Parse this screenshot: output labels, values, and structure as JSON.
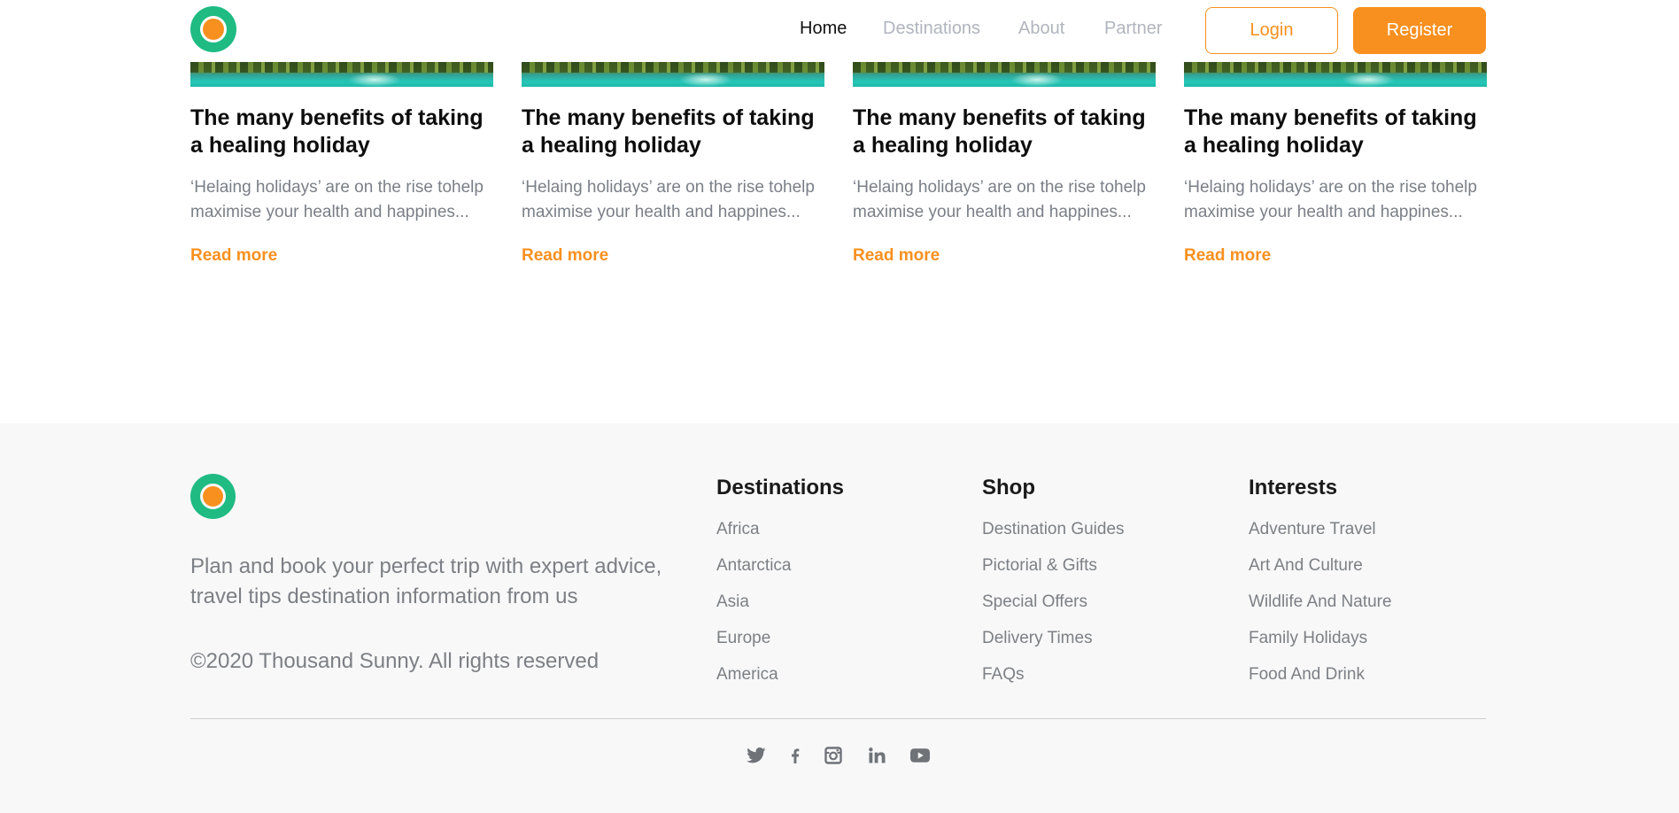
{
  "header": {
    "nav": [
      {
        "label": "Home",
        "active": true
      },
      {
        "label": "Destinations",
        "active": false
      },
      {
        "label": "About",
        "active": false
      },
      {
        "label": "Partner",
        "active": false
      }
    ],
    "login_label": "Login",
    "register_label": "Register"
  },
  "cards": [
    {
      "title": "The many benefits of taking a healing holiday",
      "excerpt": "‘Helaing holidays’ are on the rise tohelp maximise your health and happines...",
      "link": "Read more"
    },
    {
      "title": "The many benefits of taking a healing holiday",
      "excerpt": "‘Helaing holidays’ are on the rise tohelp maximise your health and happines...",
      "link": "Read more"
    },
    {
      "title": "The many benefits of taking a healing holiday",
      "excerpt": "‘Helaing holidays’ are on the rise tohelp maximise your health and happines...",
      "link": "Read more"
    },
    {
      "title": "The many benefits of taking a healing holiday",
      "excerpt": "‘Helaing holidays’ are on the rise tohelp maximise your health and happines...",
      "link": "Read more"
    }
  ],
  "footer": {
    "tagline": "Plan and book your perfect trip with expert advice, travel tips destination information from us",
    "copyright": "©2020 Thousand Sunny. All rights reserved",
    "columns": [
      {
        "title": "Destinations",
        "items": [
          "Africa",
          "Antarctica",
          "Asia",
          "Europe",
          "America"
        ]
      },
      {
        "title": "Shop",
        "items": [
          "Destination Guides",
          "Pictorial & Gifts",
          "Special Offers",
          "Delivery Times",
          "FAQs"
        ]
      },
      {
        "title": "Interests",
        "items": [
          "Adventure Travel",
          "Art And Culture",
          "Wildlife And Nature",
          "Family Holidays",
          "Food And Drink"
        ]
      }
    ],
    "socials": [
      "twitter-icon",
      "facebook-icon",
      "instagram-icon",
      "linkedin-icon",
      "youtube-icon"
    ]
  },
  "colors": {
    "accent": "#f8901f",
    "logo_green": "#1fbb83",
    "footer_bg": "#f8f8f8",
    "muted_text": "#7c7f84"
  }
}
